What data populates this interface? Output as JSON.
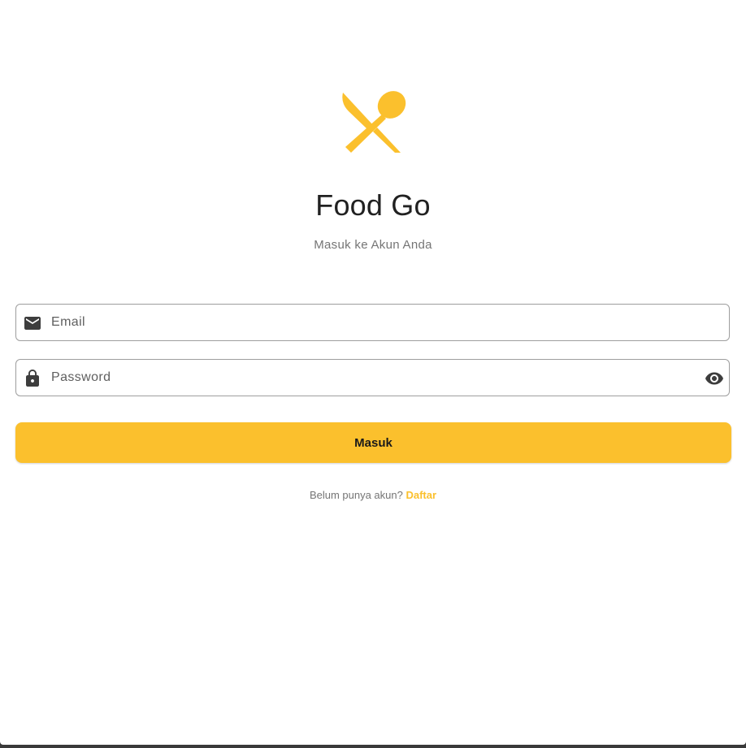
{
  "app": {
    "title": "Food Go",
    "subtitle": "Masuk ke Akun Anda",
    "logo_icon": "restaurant-icon"
  },
  "colors": {
    "accent": "#fbc02d",
    "title_text": "#212121",
    "muted_text": "#757575",
    "field_border": "#9e9e9e"
  },
  "form": {
    "email": {
      "placeholder": "Email",
      "value": "",
      "icon": "email-icon"
    },
    "password": {
      "placeholder": "Password",
      "value": "",
      "icon": "lock-icon",
      "toggle_icon": "visibility-icon"
    },
    "submit_label": "Masuk"
  },
  "register": {
    "prompt": "Belum punya akun? ",
    "link_label": "Daftar"
  }
}
